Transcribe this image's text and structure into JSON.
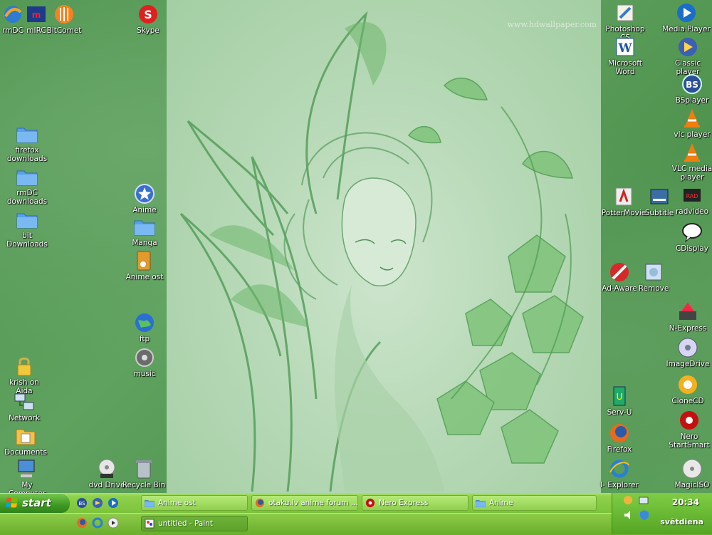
{
  "desktop": {
    "watermark": "www.hdwallpaper.com",
    "icons": [
      {
        "label": "rmDC",
        "icon": "rmdc-icon"
      },
      {
        "label": "mIRC",
        "icon": "mirc-icon"
      },
      {
        "label": "BitComet",
        "icon": "bitcomet-icon"
      },
      {
        "label": "Skype",
        "icon": "skype-icon"
      },
      {
        "label": "firefox downloads",
        "icon": "folder-icon"
      },
      {
        "label": "rmDC downloads",
        "icon": "folder-icon"
      },
      {
        "label": "bit Downloads",
        "icon": "folder-icon"
      },
      {
        "label": "Anime",
        "icon": "star-icon"
      },
      {
        "label": "Manga",
        "icon": "folder-icon"
      },
      {
        "label": "Anime ost",
        "icon": "music-folder-icon"
      },
      {
        "label": "ftp",
        "icon": "globe-icon"
      },
      {
        "label": "music",
        "icon": "music-icon"
      },
      {
        "label": "krish on Aida",
        "icon": "lock-icon"
      },
      {
        "label": "Network",
        "icon": "network-icon"
      },
      {
        "label": "Documents",
        "icon": "documents-icon"
      },
      {
        "label": "My Computer",
        "icon": "computer-icon"
      },
      {
        "label": "dvd Drive",
        "icon": "dvd-icon"
      },
      {
        "label": "Recycle Bin",
        "icon": "recycle-bin-icon"
      },
      {
        "label": "Photoshop CS",
        "icon": "photoshop-icon"
      },
      {
        "label": "Media Player",
        "icon": "media-player-icon"
      },
      {
        "label": "Microsoft Word",
        "icon": "word-icon"
      },
      {
        "label": "Classic player",
        "icon": "classic-player-icon"
      },
      {
        "label": "BSplayer",
        "icon": "bsplayer-icon"
      },
      {
        "label": "vlc player",
        "icon": "vlc-icon"
      },
      {
        "label": "VLC media player",
        "icon": "vlc-icon"
      },
      {
        "label": "radvideo",
        "icon": "radvideo-icon"
      },
      {
        "label": "PotterMovie",
        "icon": "pottermovie-icon"
      },
      {
        "label": "Subtitle",
        "icon": "subtitle-icon"
      },
      {
        "label": "CDisplay",
        "icon": "cdisplay-icon"
      },
      {
        "label": "Ad-Aware",
        "icon": "adaware-icon"
      },
      {
        "label": "Remove",
        "icon": "remove-icon"
      },
      {
        "label": "N-Express",
        "icon": "nexpress-icon"
      },
      {
        "label": "ImageDrive",
        "icon": "imagedrive-icon"
      },
      {
        "label": "CloneCD",
        "icon": "clonecd-icon"
      },
      {
        "label": "Serv-U",
        "icon": "servu-icon"
      },
      {
        "label": "Nero StartSmart",
        "icon": "nero-icon"
      },
      {
        "label": "Firefox",
        "icon": "firefox-icon"
      },
      {
        "label": "I- Explorer",
        "icon": "ie-icon"
      },
      {
        "label": "MagicISO",
        "icon": "magiciso-icon"
      }
    ]
  },
  "taskbar": {
    "start_label": "start",
    "tasks": [
      {
        "label": "Anime ost",
        "icon": "folder-icon"
      },
      {
        "label": "otaku.lv anime forum ...",
        "icon": "firefox-icon"
      },
      {
        "label": "Nero Express",
        "icon": "nero-icon"
      },
      {
        "label": "Anime",
        "icon": "folder-icon"
      },
      {
        "label": "untitled - Paint",
        "icon": "paint-icon"
      }
    ],
    "clock": "20:34",
    "day": "svētdiena"
  },
  "colors": {
    "desktop_green": "#5a9c5a",
    "taskbar_green": "#7bc33a",
    "start_green": "#3f9a24"
  }
}
